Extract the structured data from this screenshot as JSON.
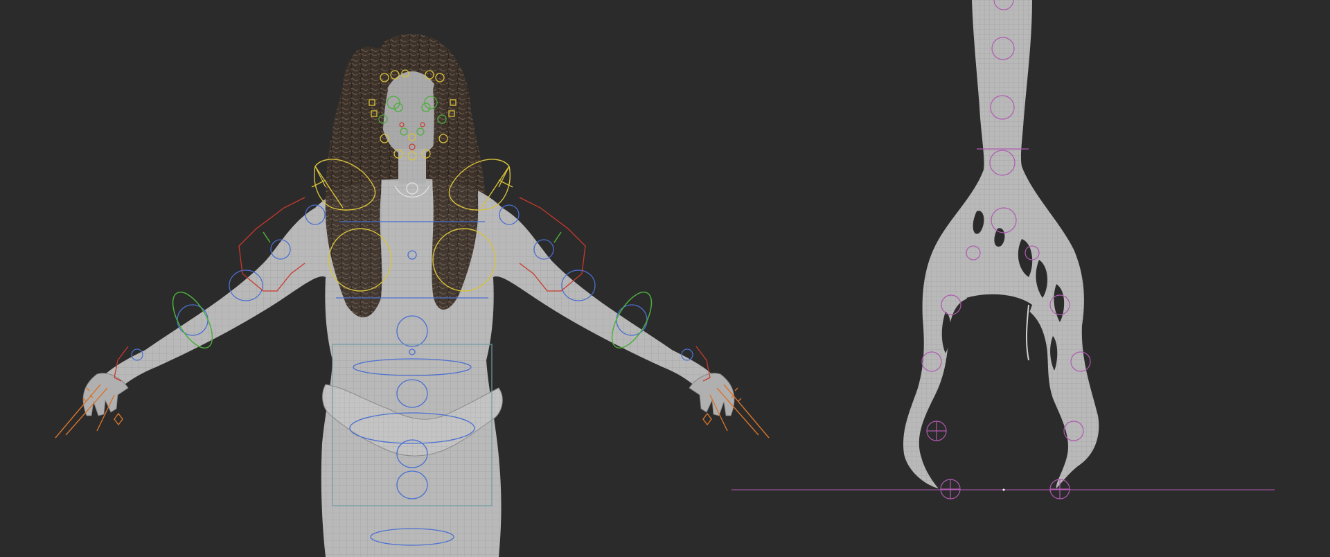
{
  "viewport": {
    "background": "#2b2b2b",
    "mesh_fill": "#b9b9b9",
    "wire_color": "#8d8d8d",
    "hair_color": "#3f342c",
    "rig_colors": {
      "yellow": "#d8c23a",
      "blue": "#4a6fd0",
      "green": "#4cae3c",
      "red": "#c8392d",
      "orange": "#d8742a",
      "magenta": "#b05ab0",
      "teal": "#6f9aa3"
    },
    "icons": {
      "ground_grid": "ground-line",
      "origin": "origin-dot"
    }
  }
}
